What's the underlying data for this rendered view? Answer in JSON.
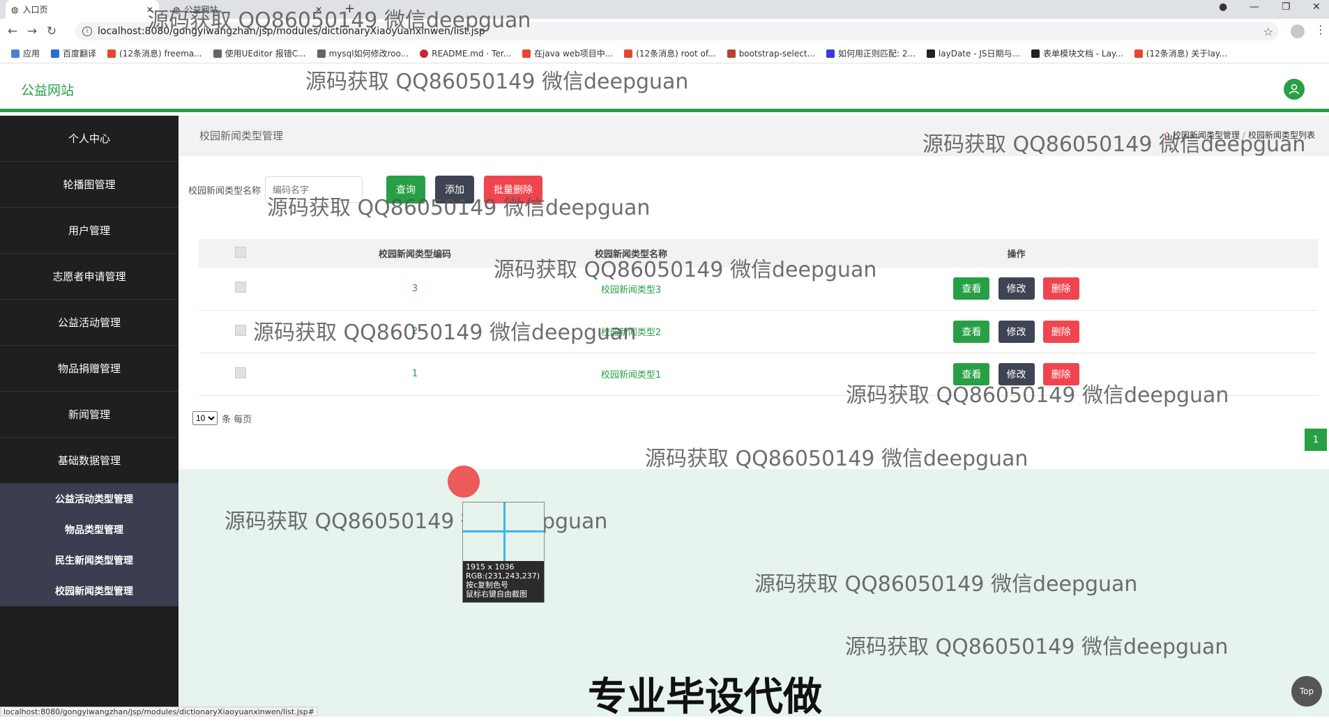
{
  "browser": {
    "tab_active": "入口页",
    "tab_second": "公益网站",
    "url": "localhost:8080/gongyiwangzhan/jsp/modules/dictionaryXiaoyuanxinwen/list.jsp",
    "bookmarks": [
      "应用",
      "百度翻译",
      "(12条消息) freema...",
      "使用UEditor 报错C...",
      "mysql如何修改roo...",
      "README.md · Ter...",
      "在java web项目中...",
      "(12条消息) root of...",
      "bootstrap-select...",
      "如何用正则匹配: 2...",
      "layDate - JS日期与...",
      "表单模块文档 - Lay...",
      "(12条消息) 关于lay..."
    ],
    "status_url": "localhost:8080/gongyiwangzhan/jsp/modules/dictionaryXiaoyuanxinwen/list.jsp#"
  },
  "header": {
    "site_title": "公益网站"
  },
  "sidebar": {
    "items": [
      "个人中心",
      "轮播图管理",
      "用户管理",
      "志愿者申请管理",
      "公益活动管理",
      "物品捐赠管理",
      "新闻管理",
      "基础数据管理"
    ],
    "sub_items": [
      "公益活动类型管理",
      "物品类型管理",
      "民生新闻类型管理",
      "校园新闻类型管理"
    ]
  },
  "page": {
    "title": "校园新闻类型管理",
    "breadcrumb": [
      "校园新闻类型管理",
      "/",
      "校园新闻类型列表"
    ]
  },
  "search": {
    "label": "校园新闻类型名称",
    "placeholder": "编码名字",
    "query_btn": "查询",
    "add_btn": "添加",
    "batch_delete_btn": "批量删除"
  },
  "table": {
    "headers": [
      "校园新闻类型编码",
      "校园新闻类型名称",
      "操作"
    ],
    "rows": [
      {
        "code": "3",
        "name": "校园新闻类型3"
      },
      {
        "code": "2",
        "name": "校园新闻类型2"
      },
      {
        "code": "1",
        "name": "校园新闻类型1"
      }
    ],
    "actions": {
      "view": "查看",
      "edit": "修改",
      "delete": "删除"
    }
  },
  "pager": {
    "page_size": "10",
    "per_page_label": "条 每页",
    "current_page": "1"
  },
  "overlays": {
    "watermark": "源码获取 QQ86050149 微信deepguan",
    "promo": "专业毕设代做",
    "magnifier_lines": [
      "1915 x 1036",
      "RGB:(231,243,237)",
      "按c复制色号",
      "鼠标右键自由截图"
    ],
    "top_btn": "Top"
  },
  "colors": {
    "primary": "#27a045",
    "dark": "#3f4454",
    "danger": "#f0454f",
    "sidebar": "#1f1f1f",
    "submenu": "#3b3e50"
  }
}
